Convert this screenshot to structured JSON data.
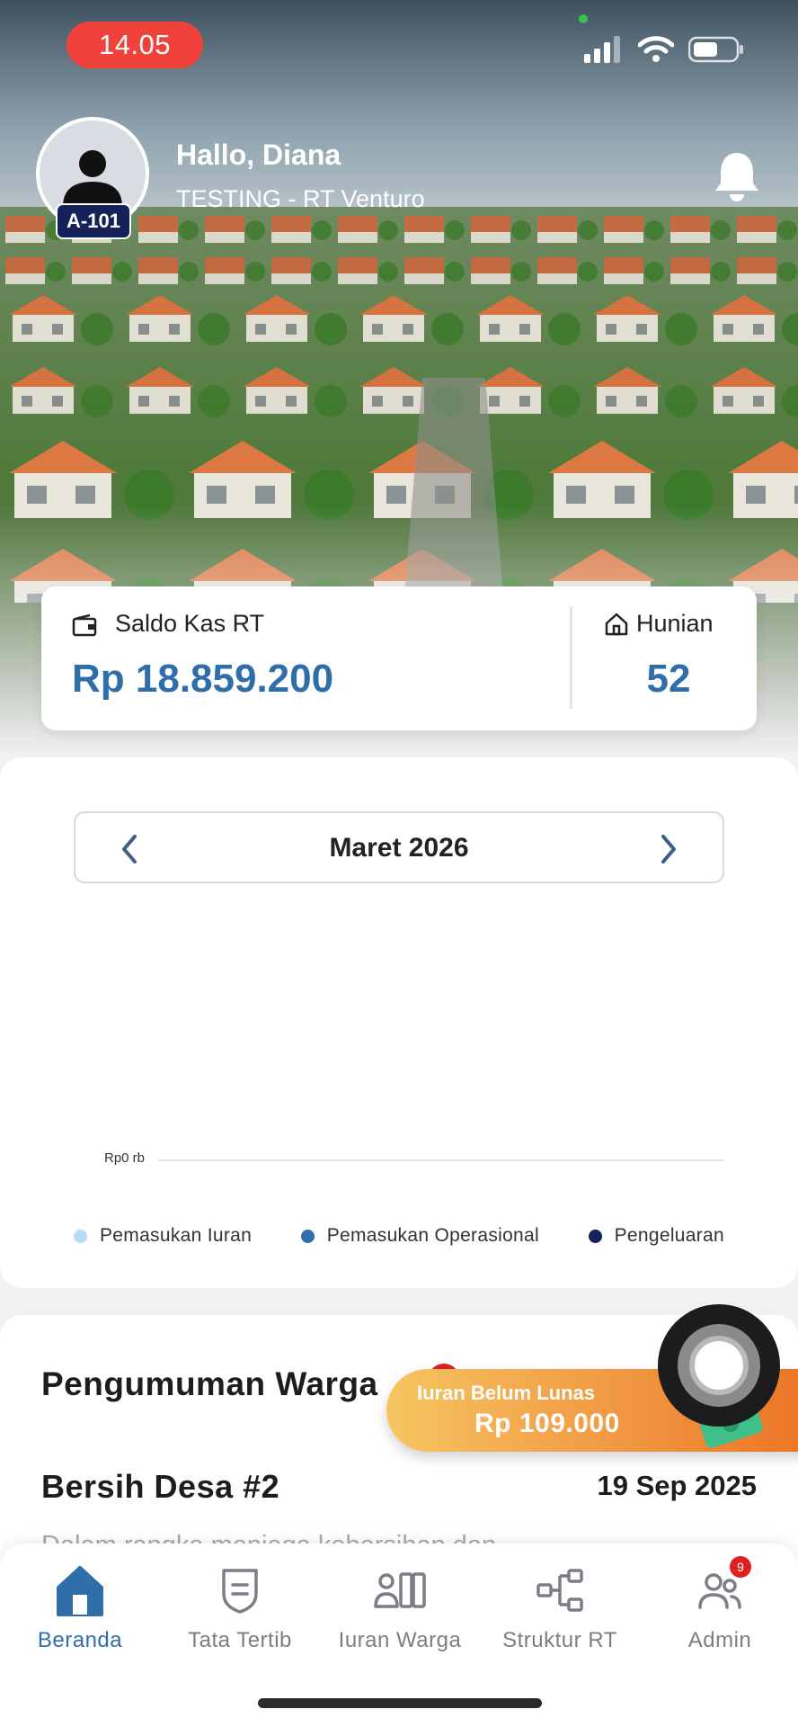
{
  "status_bar": {
    "time": "14.05"
  },
  "header": {
    "greeting": "Hallo, Diana",
    "org_name": "TESTING - RT Venturo",
    "unit_badge": "A-101",
    "avatar_icon": "user-avatar-icon",
    "notification_icon": "bell-icon"
  },
  "summary": {
    "saldo_label": "Saldo Kas RT",
    "saldo_value": "Rp 18.859.200",
    "hunian_label": "Hunian",
    "hunian_value": "52",
    "accent_color": "#2f6ea8"
  },
  "chart_data": {
    "type": "bar",
    "period_label": "Maret 2026",
    "y_tick_labels": [
      "Rp0 rb"
    ],
    "series": [
      {
        "name": "Pemasukan Iuran",
        "color": "#b9dcf6",
        "values": []
      },
      {
        "name": "Pemasukan Operasional",
        "color": "#2f6ea8",
        "values": []
      },
      {
        "name": "Pengeluaran",
        "color": "#132258",
        "values": []
      }
    ],
    "legend_position": "bottom"
  },
  "announcements": {
    "title": "Pengumuman Warga",
    "items": [
      {
        "title": "Bersih Desa #2",
        "date": "19 Sep 2025",
        "excerpt": "Dalam rangka menjaga kebersihan dan"
      }
    ]
  },
  "dues_banner": {
    "label": "Iuran Belum Lunas",
    "amount": "Rp 109.000",
    "colors": [
      "#f6c560",
      "#ec7426"
    ]
  },
  "bottom_nav": {
    "items": [
      {
        "label": "Beranda",
        "icon": "home-icon",
        "active": true
      },
      {
        "label": "Tata Tertib",
        "icon": "rules-shield-icon",
        "active": false
      },
      {
        "label": "Iuran Warga",
        "icon": "dues-payment-icon",
        "active": false
      },
      {
        "label": "Struktur RT",
        "icon": "org-structure-icon",
        "active": false
      },
      {
        "label": "Admin",
        "icon": "admin-users-icon",
        "active": false,
        "badge": "9"
      }
    ]
  }
}
